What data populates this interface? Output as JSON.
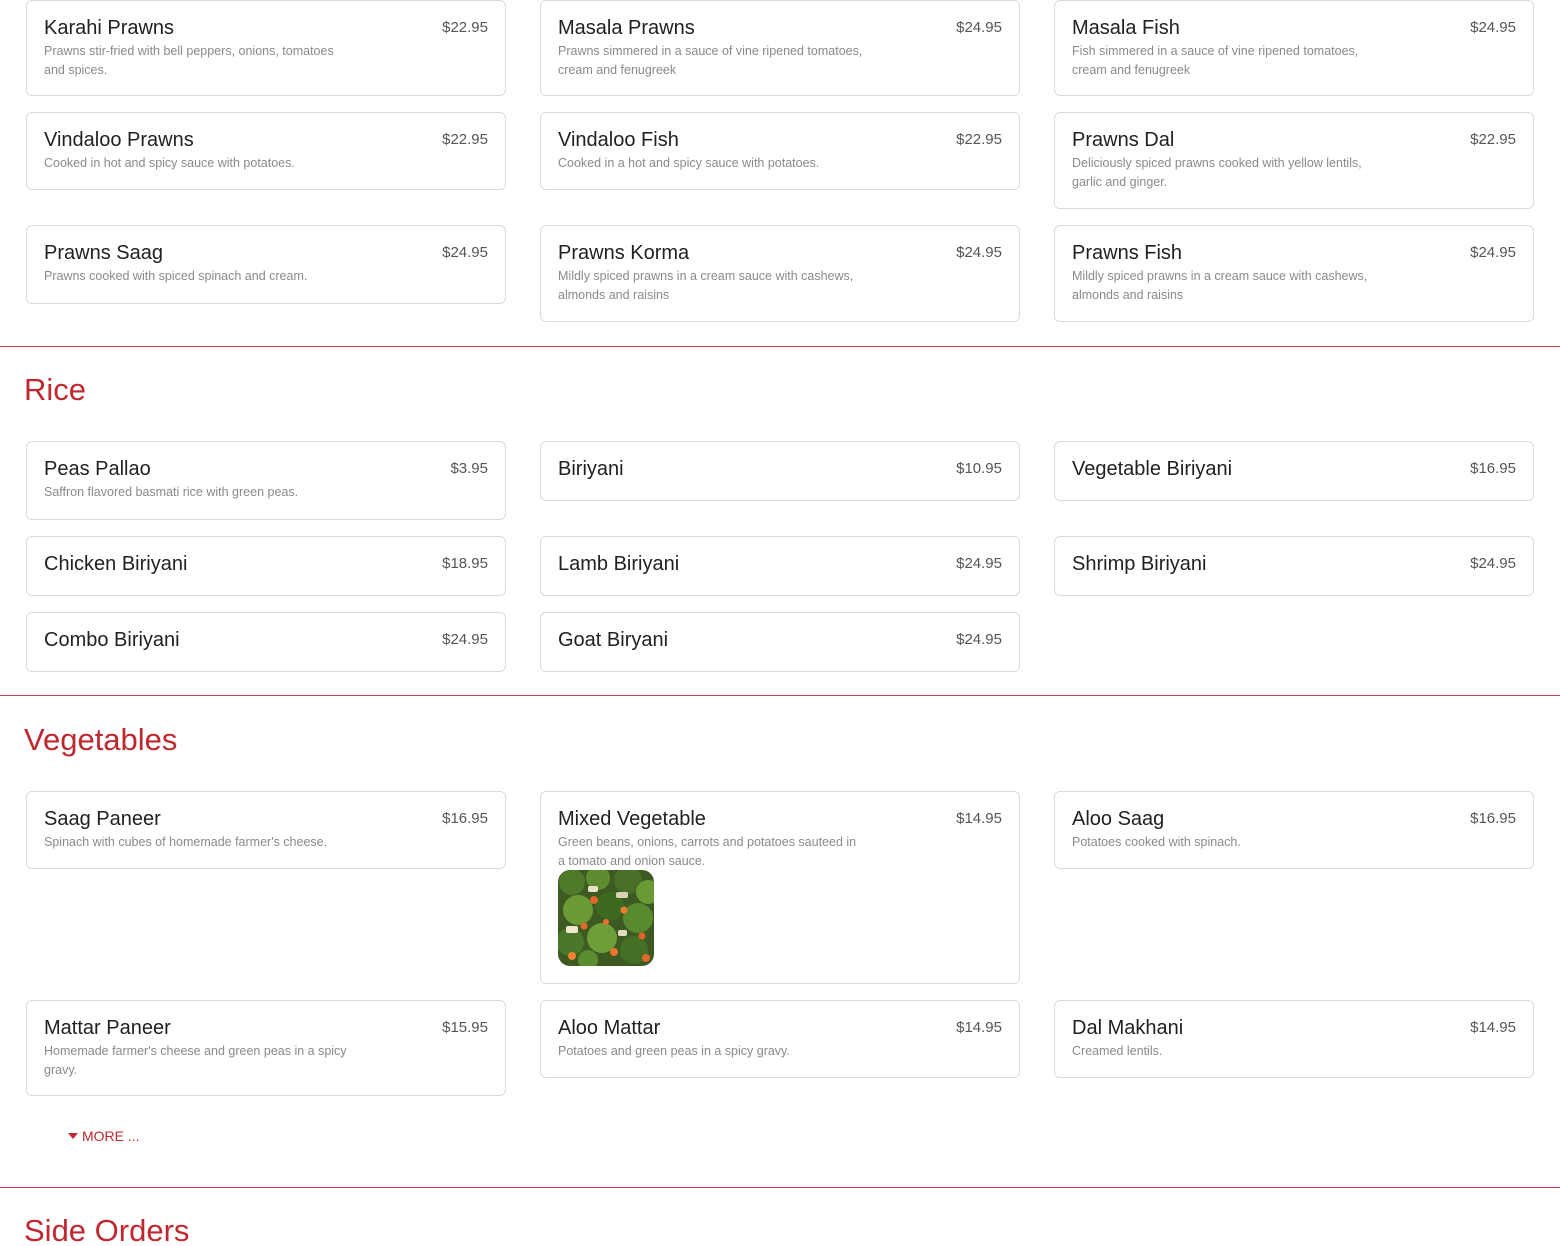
{
  "seafood": {
    "items": [
      {
        "name": "Karahi Prawns",
        "price": "$22.95",
        "desc": "Prawns stir-fried with bell peppers, onions, tomatoes and spices."
      },
      {
        "name": "Masala Prawns",
        "price": "$24.95",
        "desc": "Prawns simmered in a sauce of vine ripened tomatoes, cream and fenugreek"
      },
      {
        "name": "Masala Fish",
        "price": "$24.95",
        "desc": "Fish simmered in a sauce of vine ripened tomatoes, cream and fenugreek"
      },
      {
        "name": "Vindaloo Prawns",
        "price": "$22.95",
        "desc": "Cooked in hot and spicy sauce with potatoes."
      },
      {
        "name": "Vindaloo Fish",
        "price": "$22.95",
        "desc": "Cooked in a hot and spicy sauce with potatoes."
      },
      {
        "name": "Prawns Dal",
        "price": "$22.95",
        "desc": "Deliciously spiced prawns cooked with yellow lentils, garlic and ginger."
      },
      {
        "name": "Prawns Saag",
        "price": "$24.95",
        "desc": "Prawns cooked with spiced spinach and cream."
      },
      {
        "name": "Prawns Korma",
        "price": "$24.95",
        "desc": "Mildly spiced prawns in a cream sauce with cashews, almonds and raisins"
      },
      {
        "name": "Prawns Fish",
        "price": "$24.95",
        "desc": "Mildly spiced prawns in a cream sauce with cashews, almonds and raisins"
      }
    ]
  },
  "rice": {
    "title": "Rice",
    "items": [
      {
        "name": "Peas Pallao",
        "price": "$3.95",
        "desc": "Saffron flavored basmati rice with green peas."
      },
      {
        "name": "Biriyani",
        "price": "$10.95"
      },
      {
        "name": "Vegetable Biriyani",
        "price": "$16.95"
      },
      {
        "name": "Chicken Biriyani",
        "price": "$18.95"
      },
      {
        "name": "Lamb Biriyani",
        "price": "$24.95"
      },
      {
        "name": "Shrimp Biriyani",
        "price": "$24.95"
      },
      {
        "name": "Combo Biriyani",
        "price": "$24.95"
      },
      {
        "name": "Goat Biryani",
        "price": "$24.95"
      }
    ]
  },
  "vegetables": {
    "title": "Vegetables",
    "items": [
      {
        "name": "Saag Paneer",
        "price": "$16.95",
        "desc": "Spinach with cubes of homemade farmer's cheese."
      },
      {
        "name": "Mixed Vegetable",
        "price": "$14.95",
        "desc": "Green beans, onions, carrots and potatoes sauteed in a tomato and onion sauce."
      },
      {
        "name": "Aloo Saag",
        "price": "$16.95",
        "desc": "Potatoes cooked with spinach."
      },
      {
        "name": "Mattar Paneer",
        "price": "$15.95",
        "desc": "Homemade farmer's cheese and green peas in a spicy gravy."
      },
      {
        "name": "Aloo Mattar",
        "price": "$14.95",
        "desc": "Potatoes and green peas in a spicy gravy."
      },
      {
        "name": "Dal Makhani",
        "price": "$14.95",
        "desc": "Creamed lentils."
      }
    ],
    "more_label": "MORE ..."
  },
  "side_orders": {
    "title": "Side Orders"
  },
  "colors": {
    "accent": "#c0282f",
    "divider": "#c8474c",
    "card_border": "#dadada"
  }
}
